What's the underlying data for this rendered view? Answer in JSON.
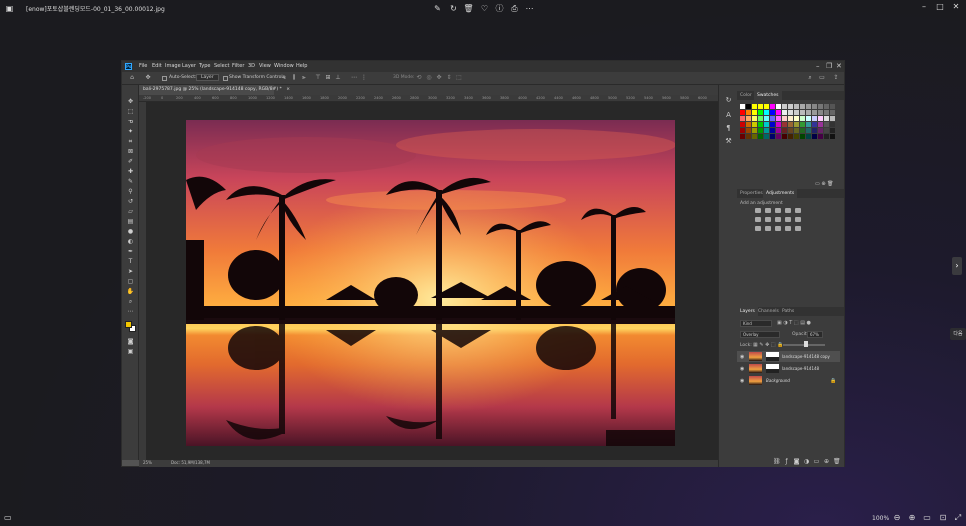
{
  "viewer": {
    "title": "[enow]포토샵블렌딩모드-00_01_36_00.00012.jpg",
    "zoom": "100%",
    "side_label": "다음"
  },
  "ps": {
    "logo": "Ps",
    "menu": [
      "File",
      "Edit",
      "Image",
      "Layer",
      "Type",
      "Select",
      "Filter",
      "3D",
      "View",
      "Window",
      "Help"
    ],
    "options": {
      "auto_select": "Auto-Select:",
      "layer_select": "Layer",
      "transform": "Show Transform Controls",
      "mode_3d": "3D Mode:"
    },
    "doc_tab": "bali-2975787.jpg @ 25% (landscape-914148 copy, RGB/8#) *",
    "ruler_ticks": [
      "-200",
      "0",
      "200",
      "400",
      "600",
      "800",
      "1000",
      "1200",
      "1400",
      "1600",
      "1800",
      "2000",
      "2200",
      "2400",
      "2600",
      "2800",
      "3000",
      "3200",
      "3400",
      "3600",
      "3800",
      "4000",
      "4200",
      "4400",
      "4600",
      "4800",
      "5000",
      "5200",
      "5400",
      "5600",
      "5800",
      "6000"
    ],
    "status": {
      "zoom": "25%",
      "doc": "Doc: 51,9M/138,7M"
    },
    "panels": {
      "top_tabs": [
        "Color",
        "Swatches"
      ],
      "mid_tabs": [
        "Properties",
        "Adjustments"
      ],
      "adj_hint": "Add an adjustment",
      "layer_tabs": [
        "Layers",
        "Channels",
        "Paths"
      ],
      "kind": "Kind",
      "blend_mode": "Overlay",
      "opacity_label": "Opacity:",
      "opacity_value": "67%",
      "lock_label": "Lock:",
      "fill_label": "Fill:",
      "layers": [
        {
          "name": "landscape-914148 copy",
          "selected": true
        },
        {
          "name": "landscape-914148",
          "selected": false
        },
        {
          "name": "Background",
          "selected": false
        }
      ]
    }
  },
  "colors": {
    "ps_blue": "#31a8ff",
    "fg_color": "#f2c600",
    "panel_bg": "#3c3c3c"
  }
}
